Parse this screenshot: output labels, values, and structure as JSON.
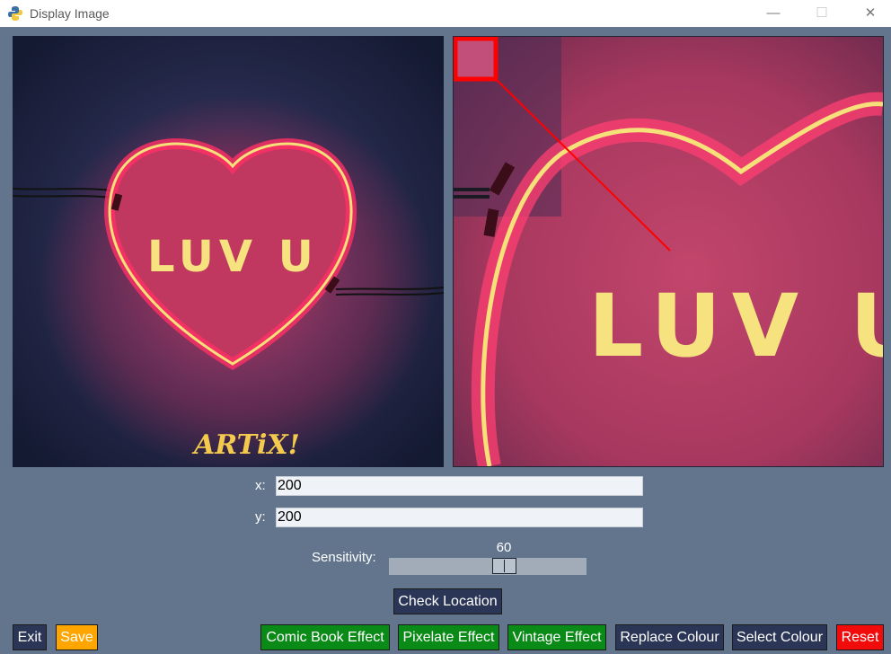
{
  "window": {
    "title": "Display Image"
  },
  "images": {
    "sign_text": "LUV U",
    "artist_tag": "ARTiX!",
    "colors": {
      "heart_neon": "#ff3d6b",
      "heart_core": "#f5e27a",
      "background": "#1c2340",
      "selection_box": "#ff0000"
    }
  },
  "form": {
    "x_label": "x:",
    "x_value": "200",
    "y_label": "y:",
    "y_value": "200",
    "sensitivity_label": "Sensitivity:",
    "sensitivity_value": "60"
  },
  "buttons": {
    "check_location": "Check Location",
    "exit": "Exit",
    "save": "Save",
    "comic_book": "Comic Book Effect",
    "pixelate": "Pixelate Effect",
    "vintage": "Vintage Effect",
    "replace_colour": "Replace Colour",
    "select_colour": "Select Colour",
    "reset": "Reset"
  }
}
